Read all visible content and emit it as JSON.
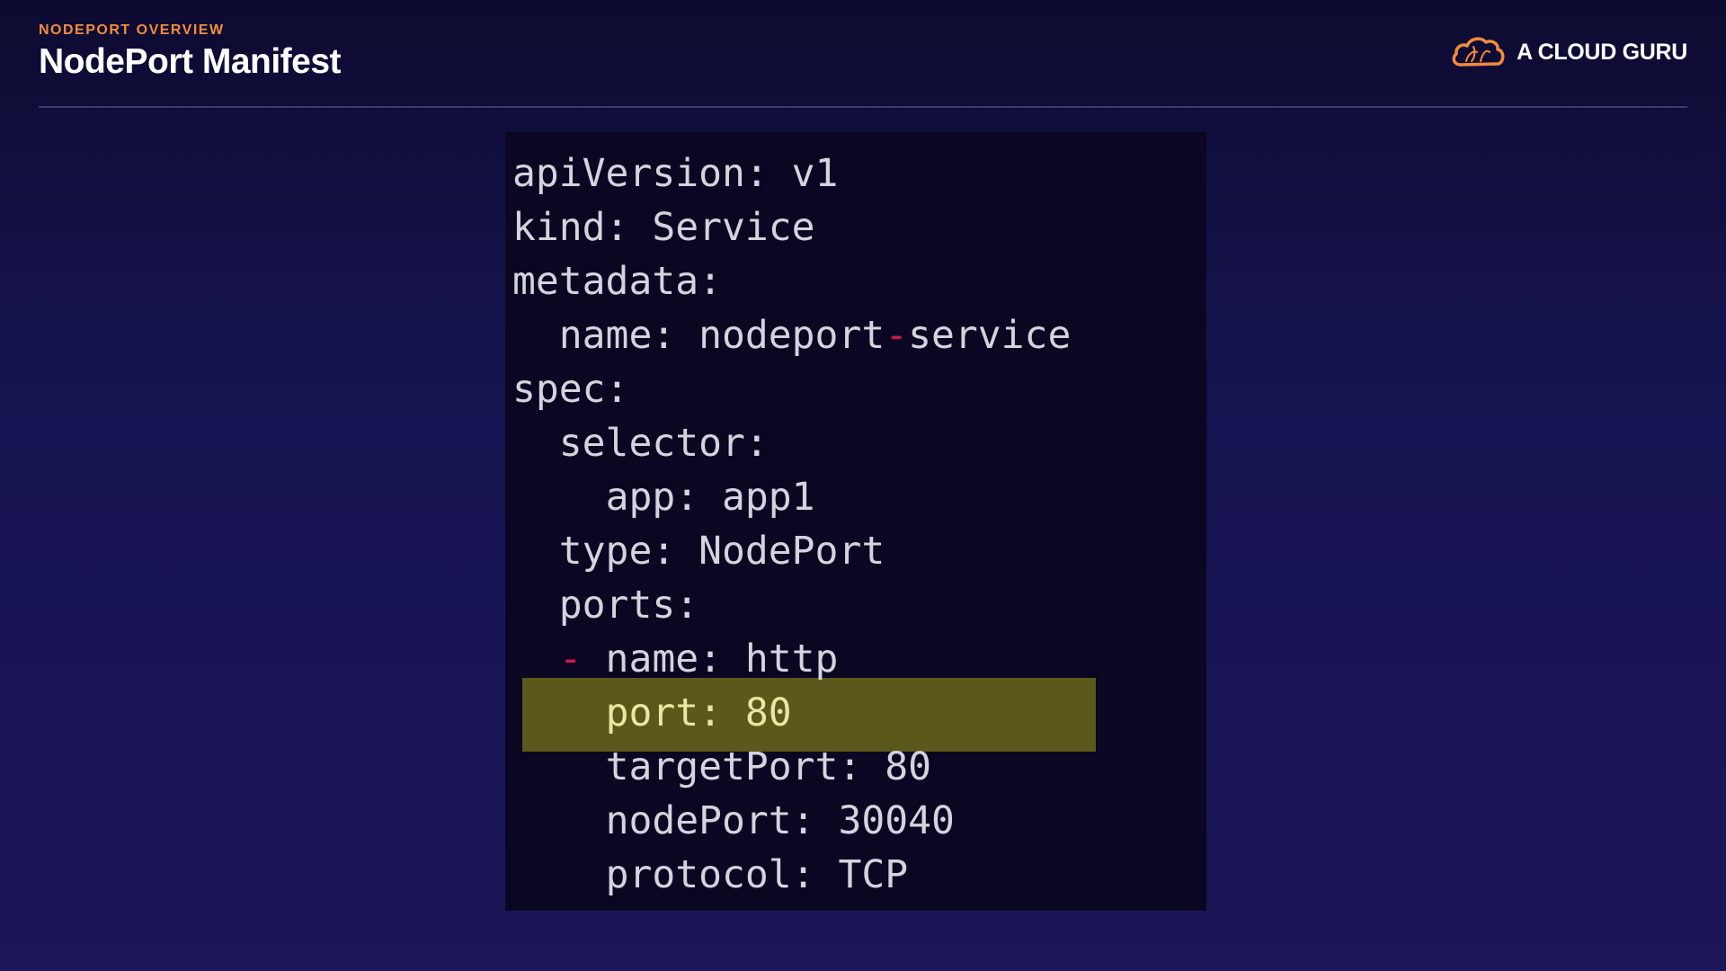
{
  "header": {
    "section_label": "NODEPORT OVERVIEW",
    "title": "NodePort Manifest"
  },
  "brand": {
    "name": "A CLOUD GURU",
    "icon": "cloud-logo-icon",
    "accent_color": "#f58a3d"
  },
  "code": {
    "lines": [
      {
        "indent": "",
        "dash": "",
        "text": "apiVersion: v1"
      },
      {
        "indent": "",
        "dash": "",
        "text": "kind: Service"
      },
      {
        "indent": "",
        "dash": "",
        "text": "metadata:"
      },
      {
        "indent": "  ",
        "dash": "",
        "text": "name: nodeport",
        "dash_mid": "-",
        "text_after": "service"
      },
      {
        "indent": "",
        "dash": "",
        "text": "spec:"
      },
      {
        "indent": "  ",
        "dash": "",
        "text": "selector:"
      },
      {
        "indent": "    ",
        "dash": "",
        "text": "app: app1"
      },
      {
        "indent": "  ",
        "dash": "",
        "text": "type: NodePort"
      },
      {
        "indent": "  ",
        "dash": "",
        "text": "ports:"
      },
      {
        "indent": "  ",
        "dash": "-",
        "text": " name: http"
      },
      {
        "indent": "    ",
        "dash": "",
        "text": "port: 80"
      },
      {
        "indent": "    ",
        "dash": "",
        "text": "targetPort: 80"
      },
      {
        "indent": "    ",
        "dash": "",
        "text": "nodePort: 30040"
      },
      {
        "indent": "    ",
        "dash": "",
        "text": "protocol: TCP"
      }
    ],
    "highlighted_line": 10,
    "highlight_color": "#5a591b",
    "dash_color": "#d0174f"
  }
}
